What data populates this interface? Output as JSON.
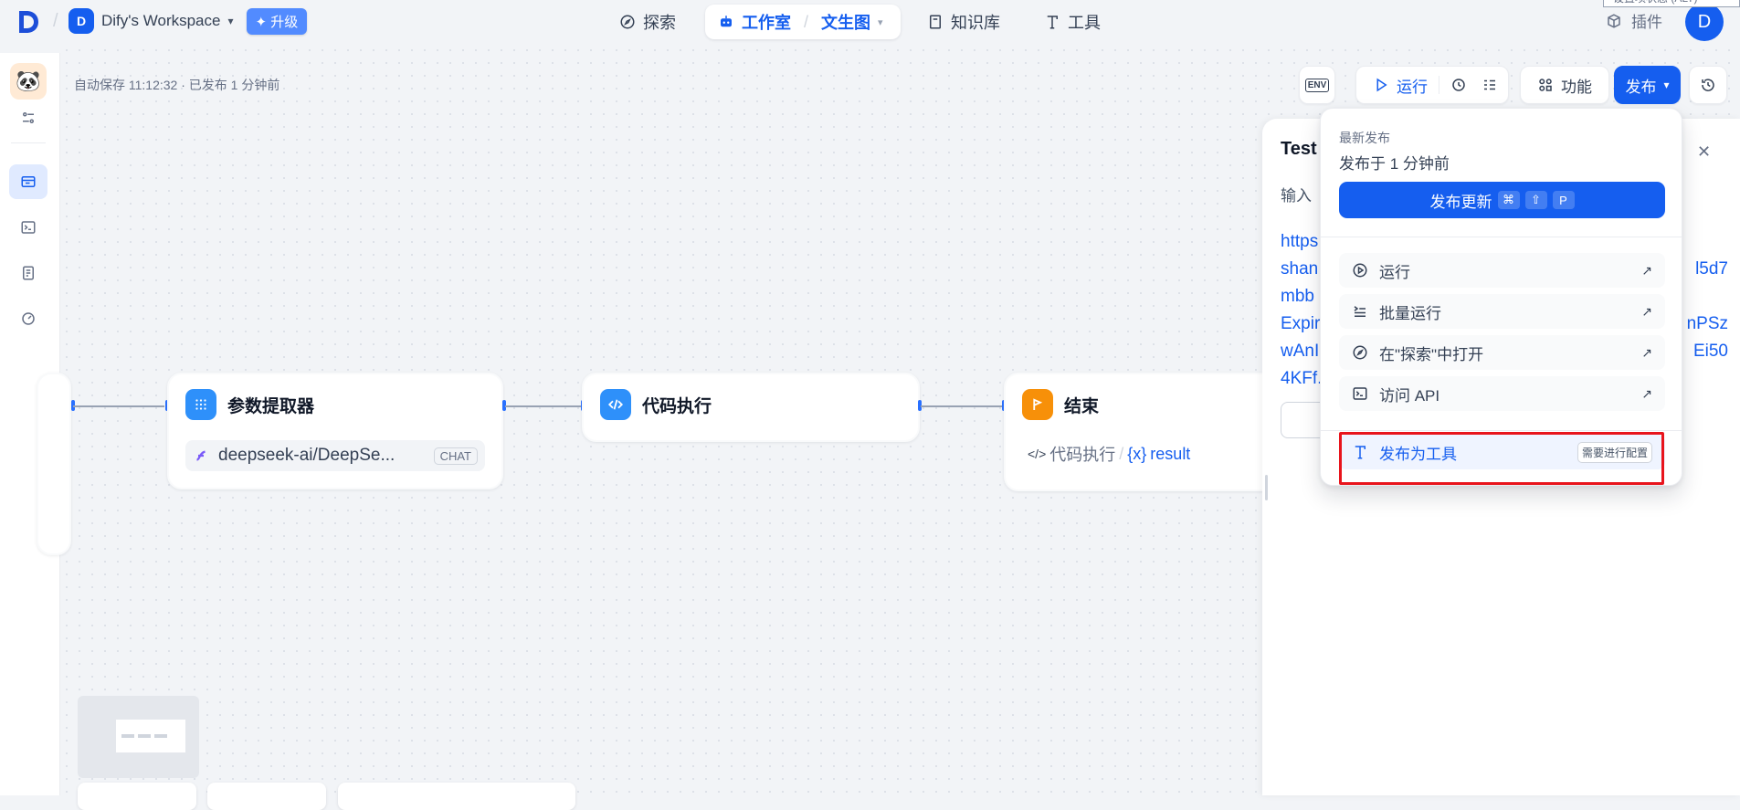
{
  "header": {
    "workspace_initial": "D",
    "workspace_name": "Dify's Workspace",
    "upgrade_label": "升级",
    "nav_explore": "探索",
    "nav_studio": "工作室",
    "nav_studio_sub": "文生图",
    "nav_knowledge": "知识库",
    "nav_tools": "工具",
    "plugins": "插件",
    "user_initial": "D",
    "tooltip": "设置项状态 (ALT)"
  },
  "status": {
    "autosave": "自动保存 11:12:32 · 已发布 1 分钟前"
  },
  "toolbar": {
    "env": "ENV",
    "run": "运行",
    "features": "功能",
    "publish": "发布"
  },
  "nodes": {
    "extractor_title": "参数提取器",
    "extractor_model": "deepseek-ai/DeepSe...",
    "extractor_model_tag": "CHAT",
    "code_title": "代码执行",
    "end_title": "结束",
    "end_source": "代码执行",
    "end_sep": "/",
    "end_var_icon": "{x}",
    "end_var": "result"
  },
  "panel": {
    "title": "Test",
    "input_label": "输入",
    "url_lines": [
      "https",
      "shan",
      "mbb",
      "Expir",
      "wAnI",
      "4KFf."
    ],
    "url_right": [
      "",
      "l5d7",
      "",
      "nPSz",
      "Ei50",
      ""
    ]
  },
  "dropdown": {
    "latest_label": "最新发布",
    "published_time": "发布于 1 分钟前",
    "publish_update": "发布更新",
    "kbd": [
      "⌘",
      "⇧",
      "P"
    ],
    "items": [
      {
        "label": "运行",
        "icon": "play-circle-icon"
      },
      {
        "label": "批量运行",
        "icon": "batch-run-icon"
      },
      {
        "label": "在\"探索\"中打开",
        "icon": "explore-icon"
      },
      {
        "label": "访问 API",
        "icon": "terminal-icon"
      }
    ],
    "publish_as_tool": "发布为工具",
    "needs_config": "需要进行配置"
  },
  "colors": {
    "primary": "#155eef",
    "highlight": "#e8141c",
    "code_node": "#2e90fa",
    "end_node": "#f79009"
  }
}
